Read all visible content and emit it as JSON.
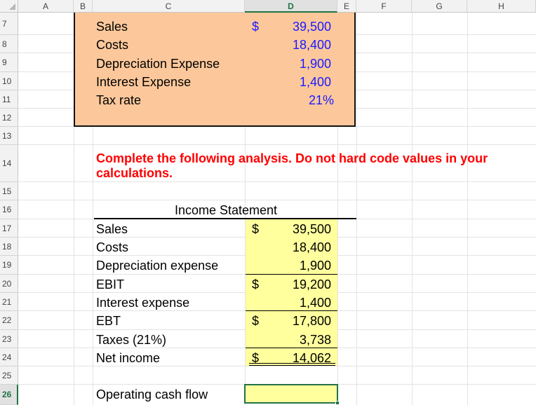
{
  "columns": [
    "A",
    "B",
    "C",
    "D",
    "E",
    "F",
    "G",
    "H"
  ],
  "rows": [
    "7",
    "8",
    "9",
    "10",
    "11",
    "12",
    "13",
    "14",
    "15",
    "16",
    "17",
    "18",
    "19",
    "20",
    "21",
    "22",
    "23",
    "24",
    "25",
    "26"
  ],
  "selected_row": "26",
  "input_box": {
    "sales_label": "Sales",
    "sales_sym": "$",
    "sales_val": "39,500",
    "costs_label": "Costs",
    "costs_val": "18,400",
    "dep_label": "Depreciation Expense",
    "dep_val": "1,900",
    "int_label": "Interest Expense",
    "int_val": "1,400",
    "tax_label": "Tax rate",
    "tax_val": "21%"
  },
  "instruction": "Complete the following analysis. Do not hard code values in your calculations.",
  "income_statement": {
    "title": "Income Statement",
    "sales_label": "Sales",
    "sales_sym": "$",
    "sales_val": "39,500",
    "costs_label": "Costs",
    "costs_val": "18,400",
    "dep_label": "Depreciation expense",
    "dep_val": "1,900",
    "ebit_label": "EBIT",
    "ebit_sym": "$",
    "ebit_val": "19,200",
    "int_label": "Interest expense",
    "int_val": "1,400",
    "ebt_label": "EBT",
    "ebt_sym": "$",
    "ebt_val": "17,800",
    "tax_label": "Taxes (21%)",
    "tax_val": "3,738",
    "ni_label": "Net income",
    "ni_sym": "$",
    "ni_val": "14,062"
  },
  "ocf_label": "Operating cash flow",
  "colors": {
    "input_fill": "#fcc89b",
    "result_fill": "#ffff9e",
    "instruction": "#ff0000",
    "input_value": "#1a1aff",
    "selection": "#217346"
  }
}
